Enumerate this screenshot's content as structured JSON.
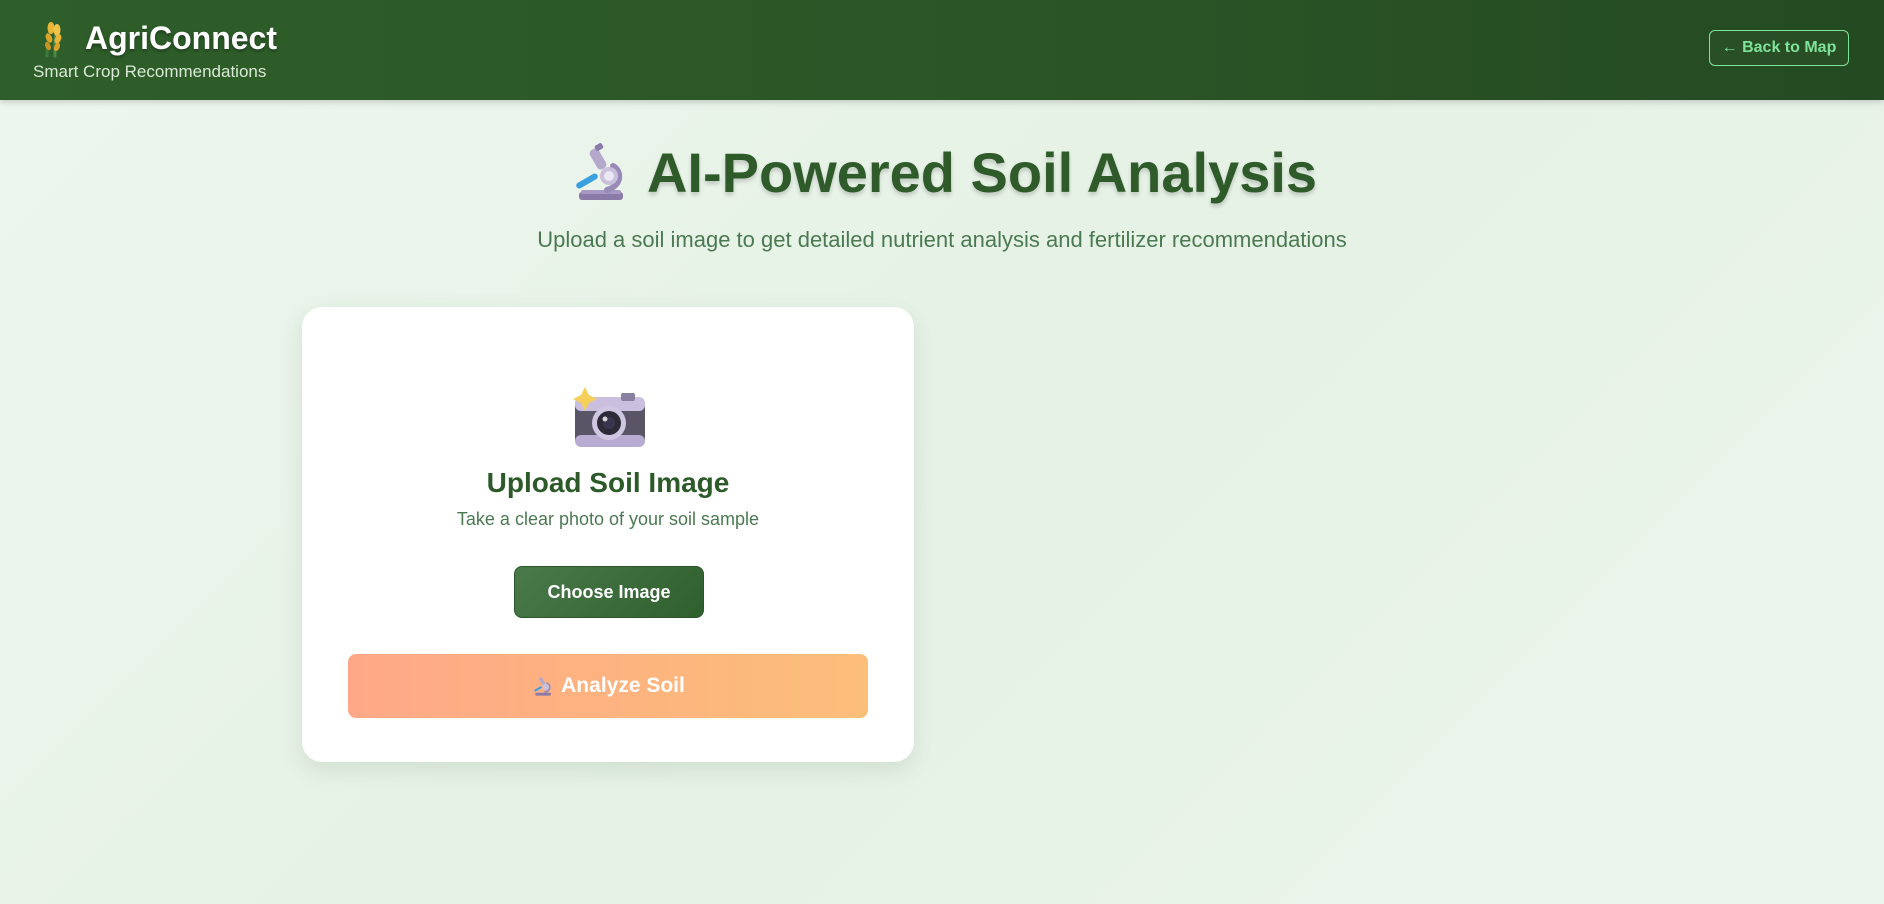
{
  "header": {
    "logo_icon": "wheat-icon",
    "brand_title": "AgriConnect",
    "brand_subtitle": "Smart Crop Recommendations",
    "back_button_label": "← Back to Map"
  },
  "hero": {
    "icon": "microscope-icon",
    "title": "AI-Powered Soil Analysis",
    "subtitle": "Upload a soil image to get detailed nutrient analysis and fertilizer recommendations"
  },
  "upload_card": {
    "icon": "camera-icon",
    "title": "Upload Soil Image",
    "subtitle": "Take a clear photo of your soil sample",
    "choose_button_label": "Choose Image",
    "analyze_button_label": "Analyze Soil",
    "analyze_icon": "microscope-icon"
  },
  "colors": {
    "header_bg": "#2e5e2a",
    "accent_green": "#7fe39a",
    "title_green": "#2f5a2a",
    "analyze_gradient_start": "#ffa888",
    "analyze_gradient_end": "#fcbf7a"
  }
}
